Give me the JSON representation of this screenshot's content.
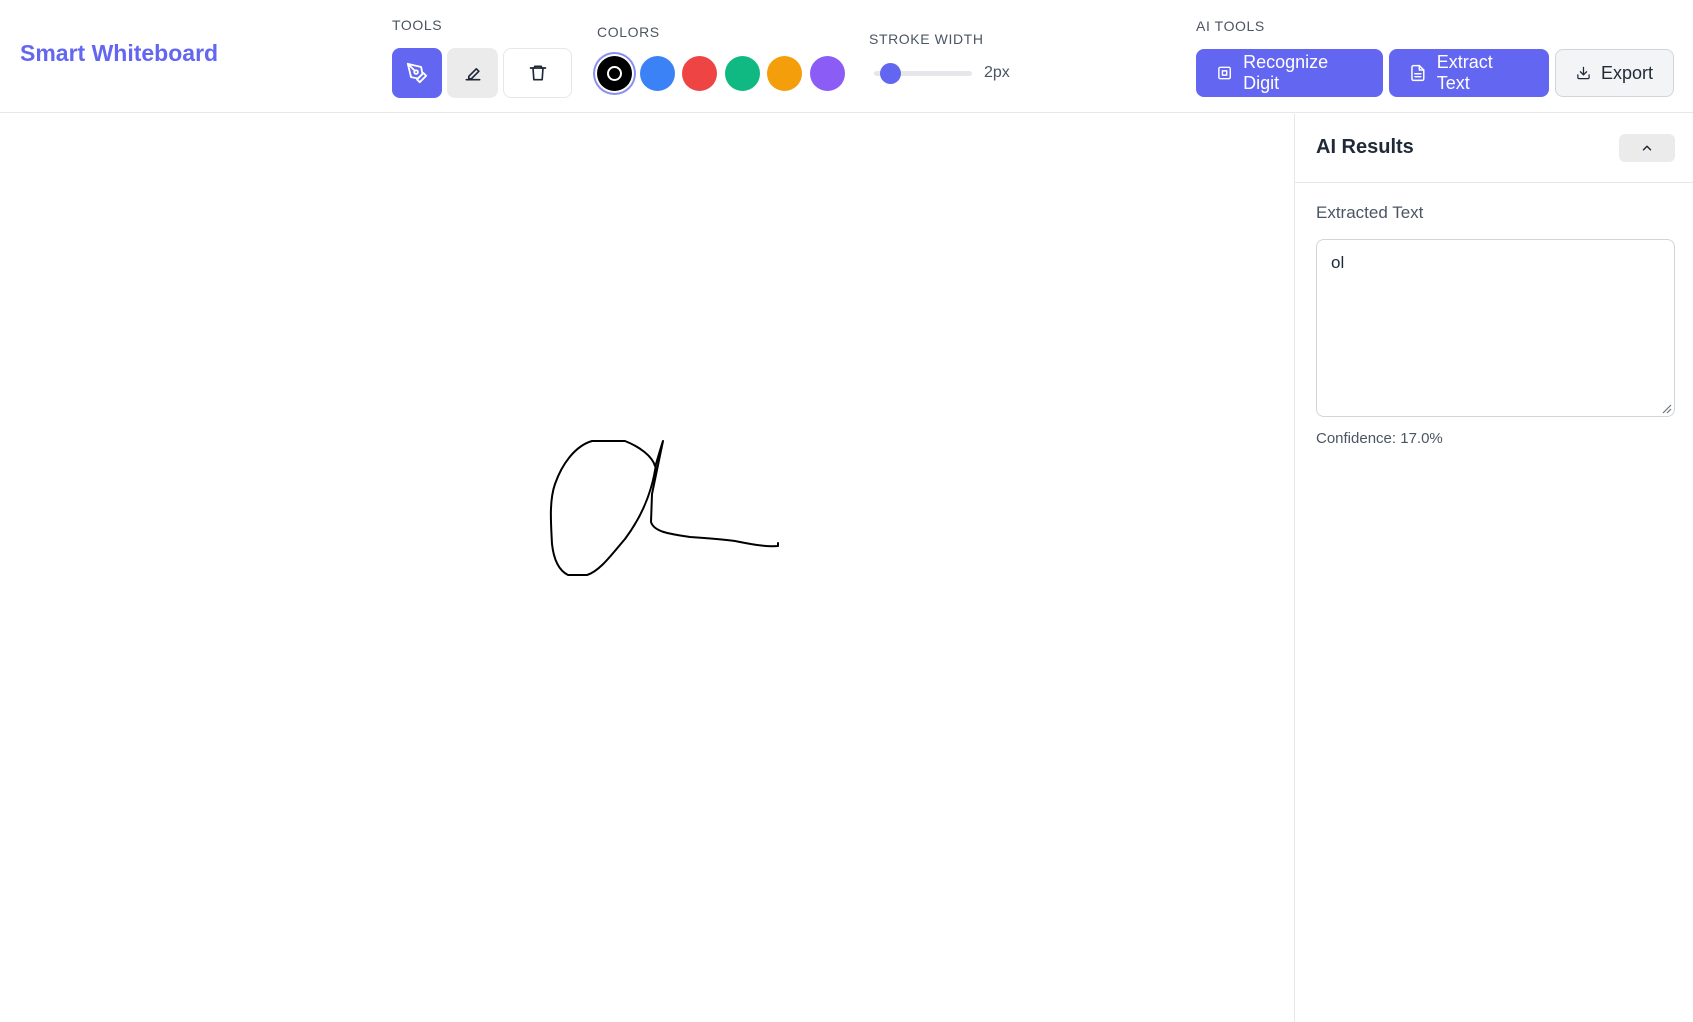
{
  "app": {
    "title": "Smart Whiteboard"
  },
  "toolbar": {
    "tools_label": "TOOLS",
    "colors_label": "COLORS",
    "stroke_label": "STROKE WIDTH",
    "stroke_value": "2px",
    "stroke_level_fraction": 0.1,
    "ai_tools_label": "AI TOOLS",
    "tools": [
      {
        "icon": "pen-icon",
        "active": true
      },
      {
        "icon": "eraser-icon",
        "active": false
      },
      {
        "icon": "trash-icon",
        "active": false
      }
    ],
    "colors": [
      "#000000",
      "#3b82f6",
      "#ef4444",
      "#10b981",
      "#f59e0b",
      "#8b5cf6"
    ],
    "selected_color": "#000000",
    "ai_buttons": {
      "recognize_digit": "Recognize Digit",
      "extract_text": "Extract Text",
      "export": "Export"
    }
  },
  "sidebar": {
    "title": "AI Results",
    "section_label": "Extracted Text",
    "extracted_text": "ol",
    "confidence": "Confidence: 17.0%"
  },
  "colors": {
    "accent": "#6366f1"
  }
}
